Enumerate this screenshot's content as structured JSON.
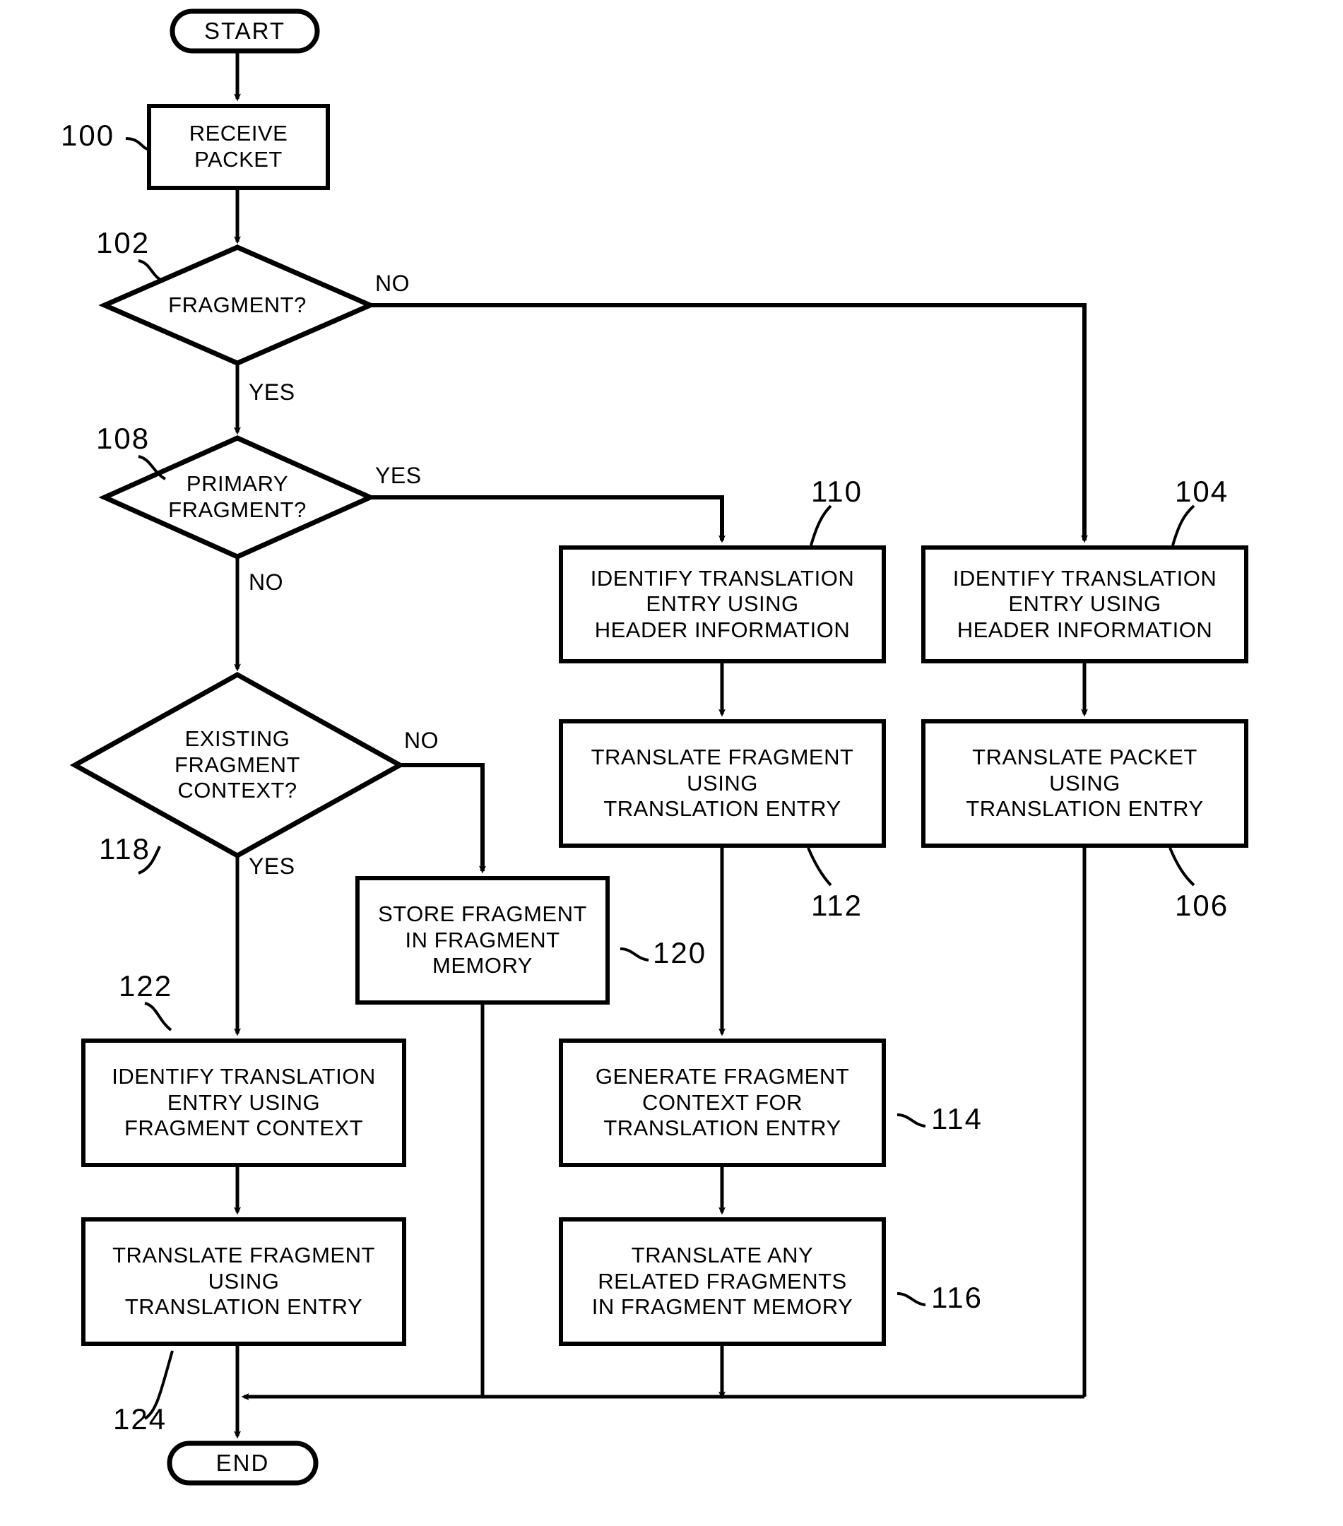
{
  "diagram": {
    "title": "Packet fragment translation flowchart",
    "line_color": "#000000",
    "background_color": "#ffffff"
  },
  "terminators": [
    {
      "id": "start",
      "label": "START"
    },
    {
      "id": "end",
      "label": "END"
    }
  ],
  "process_boxes": [
    {
      "id": "receive_packet",
      "label": "RECEIVE\nPACKET",
      "ref": "100"
    },
    {
      "id": "identify_translation_header_a",
      "label": "IDENTIFY TRANSLATION\nENTRY USING\nHEADER INFORMATION",
      "ref": "110"
    },
    {
      "id": "identify_translation_header_b",
      "label": "IDENTIFY TRANSLATION\nENTRY USING\nHEADER INFORMATION",
      "ref": "104"
    },
    {
      "id": "translate_fragment_a",
      "label": "TRANSLATE FRAGMENT\nUSING\nTRANSLATION ENTRY",
      "ref": "112"
    },
    {
      "id": "translate_packet",
      "label": "TRANSLATE PACKET\nUSING\nTRANSLATION ENTRY",
      "ref": "106"
    },
    {
      "id": "store_fragment",
      "label": "STORE FRAGMENT\nIN FRAGMENT\nMEMORY",
      "ref": "120"
    },
    {
      "id": "identify_translation_context",
      "label": "IDENTIFY TRANSLATION\nENTRY USING\nFRAGMENT CONTEXT",
      "ref": "122"
    },
    {
      "id": "generate_fragment_context",
      "label": "GENERATE FRAGMENT\nCONTEXT FOR\nTRANSLATION ENTRY",
      "ref": "114"
    },
    {
      "id": "translate_fragment_b",
      "label": "TRANSLATE FRAGMENT\nUSING\nTRANSLATION ENTRY",
      "ref": "124"
    },
    {
      "id": "translate_related_fragments",
      "label": "TRANSLATE ANY\nRELATED FRAGMENTS\nIN FRAGMENT MEMORY",
      "ref": "116"
    }
  ],
  "decisions": [
    {
      "id": "fragment",
      "label": "FRAGMENT?",
      "ref": "102",
      "yes_label": "YES",
      "no_label": "NO"
    },
    {
      "id": "primary_fragment",
      "label": "PRIMARY\nFRAGMENT?",
      "ref": "108",
      "yes_label": "YES",
      "no_label": "NO"
    },
    {
      "id": "existing_fragment_context",
      "label": "EXISTING\nFRAGMENT\nCONTEXT?",
      "ref": "118",
      "yes_label": "YES",
      "no_label": "NO"
    }
  ],
  "reference_numerals": [
    {
      "id": "ref-100",
      "value": "100"
    },
    {
      "id": "ref-102",
      "value": "102"
    },
    {
      "id": "ref-104",
      "value": "104"
    },
    {
      "id": "ref-106",
      "value": "106"
    },
    {
      "id": "ref-108",
      "value": "108"
    },
    {
      "id": "ref-110",
      "value": "110"
    },
    {
      "id": "ref-112",
      "value": "112"
    },
    {
      "id": "ref-114",
      "value": "114"
    },
    {
      "id": "ref-116",
      "value": "116"
    },
    {
      "id": "ref-118",
      "value": "118"
    },
    {
      "id": "ref-120",
      "value": "120"
    },
    {
      "id": "ref-122",
      "value": "122"
    },
    {
      "id": "ref-124",
      "value": "124"
    }
  ],
  "edge_labels": {
    "fragment_no": "NO",
    "fragment_yes": "YES",
    "primary_yes": "YES",
    "primary_no": "NO",
    "context_no": "NO",
    "context_yes": "YES"
  }
}
